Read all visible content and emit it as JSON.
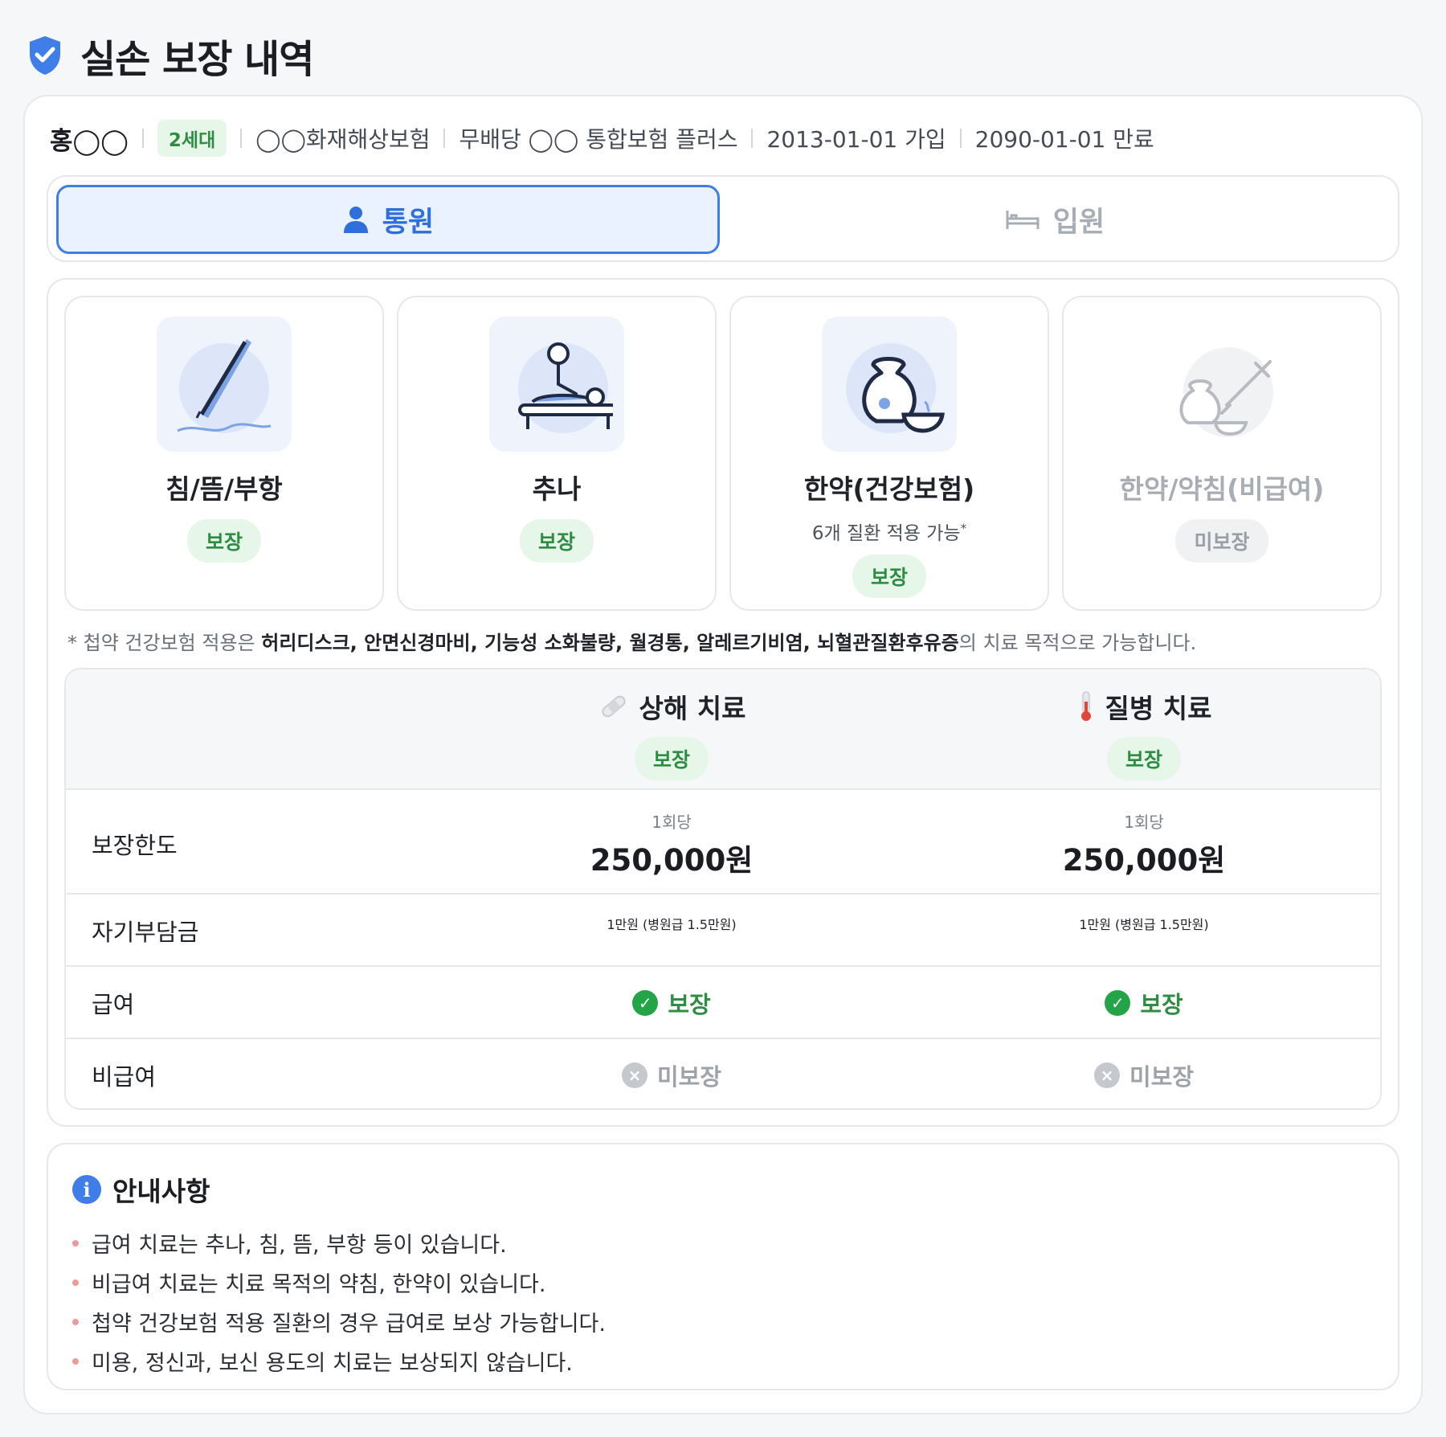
{
  "page": {
    "title": "실손 보장 내역"
  },
  "policy": {
    "holder": "홍◯◯",
    "generation": "2세대",
    "company": "◯◯화재해상보험",
    "product": "무배당 ◯◯ 통합보험 플러스",
    "join_date": "2013-01-01 가입",
    "expiry_date": "2090-01-01 만료"
  },
  "tabs": [
    {
      "label": "통원",
      "icon": "person-icon",
      "active": true
    },
    {
      "label": "입원",
      "icon": "bed-icon",
      "active": false
    }
  ],
  "treatments": [
    {
      "name": "침/뜸/부항",
      "icon": "acupuncture-needle-icon",
      "status": "보장",
      "covered": true
    },
    {
      "name": "추나",
      "icon": "chuna-therapy-icon",
      "status": "보장",
      "covered": true
    },
    {
      "name": "한약(건강보험)",
      "icon": "herbal-medicine-icon",
      "sub": "6개 질환 적용 가능",
      "sub_mark": "*",
      "status": "보장",
      "covered": true
    },
    {
      "name": "한약/약침(비급여)",
      "icon": "herbal-injection-icon",
      "status": "미보장",
      "covered": false
    }
  ],
  "footnote": {
    "prefix": "* 첩약 건강보험 적용은 ",
    "bold": "허리디스크, 안면신경마비, 기능성 소화불량, 월경통, 알레르기비염, 뇌혈관질환후유증",
    "suffix": "의 치료 목적으로 가능합니다."
  },
  "table": {
    "columns": [
      {
        "title": "상해 치료",
        "icon": "bandage-icon",
        "status": "보장"
      },
      {
        "title": "질병 치료",
        "icon": "thermometer-icon",
        "status": "보장"
      }
    ],
    "rows": {
      "limit": {
        "label": "보장한도",
        "per": "1회당",
        "values": [
          "250,000원",
          "250,000원"
        ]
      },
      "deductible": {
        "label": "자기부담금",
        "values": [
          "1만원 (병원급 1.5만원)",
          "1만원 (병원급 1.5만원)"
        ]
      },
      "covered": {
        "label": "급여",
        "values": [
          "보장",
          "보장"
        ]
      },
      "noncovered": {
        "label": "비급여",
        "values": [
          "미보장",
          "미보장"
        ]
      }
    }
  },
  "notice": {
    "title": "안내사항",
    "items": [
      "급여 치료는 추나, 침, 뜸, 부항 등이 있습니다.",
      "비급여 치료는 치료 목적의 약침, 한약이 있습니다.",
      "첩약 건강보험 적용 질환의 경우 급여로 보상 가능합니다.",
      "미용, 정신과, 보신 용도의 치료는 보상되지 않습니다."
    ]
  },
  "colors": {
    "accent": "#3f7ee8",
    "covered_green": "#2f8d43",
    "not_covered_gray": "#9ea3aa"
  }
}
